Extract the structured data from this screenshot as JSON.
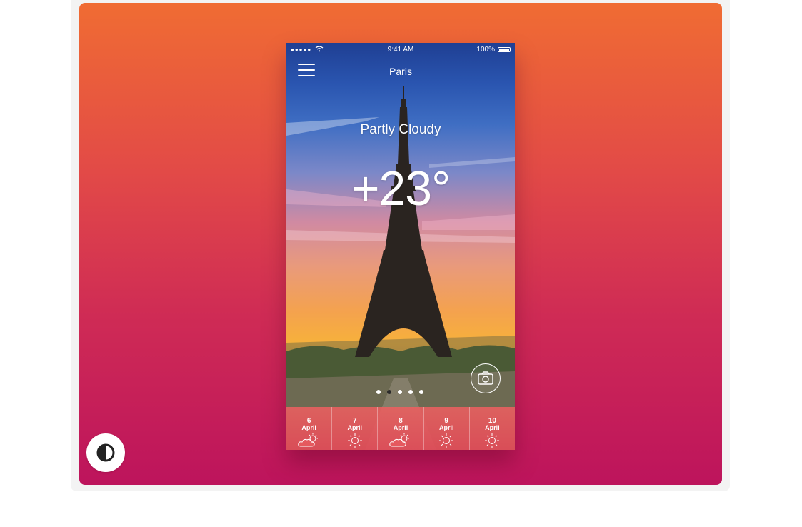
{
  "status_bar": {
    "signal": "●●●●●",
    "time": "9:41 AM",
    "battery": "100%"
  },
  "header": {
    "city": "Paris"
  },
  "weather": {
    "condition": "Partly Cloudy",
    "temperature": "+23°"
  },
  "pager": {
    "count": 5,
    "active_index": 1
  },
  "forecast": [
    {
      "day": "6",
      "month": "April",
      "icon": "partly-cloudy-icon"
    },
    {
      "day": "7",
      "month": "April",
      "icon": "sun-icon"
    },
    {
      "day": "8",
      "month": "April",
      "icon": "partly-cloudy-icon"
    },
    {
      "day": "9",
      "month": "April",
      "icon": "sun-icon"
    },
    {
      "day": "10",
      "month": "April",
      "icon": "sun-icon"
    }
  ],
  "colors": {
    "background_top": "#f06c33",
    "background_bottom": "#bd145c",
    "forecast_bar": "#e55a5e",
    "active_dot": "#2b2b2b"
  }
}
